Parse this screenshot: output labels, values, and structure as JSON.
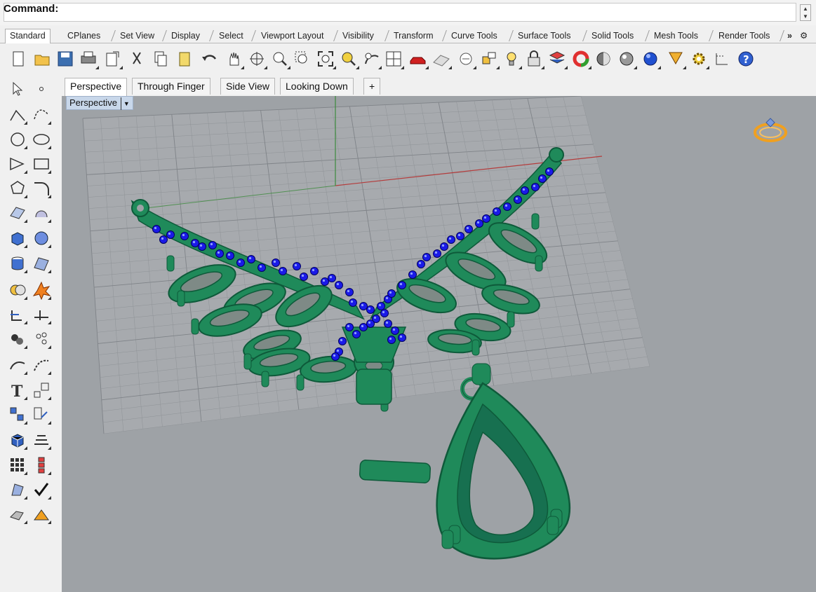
{
  "command": {
    "label": "Command:",
    "value": ""
  },
  "toolbar_tabs": [
    "Standard",
    "CPlanes",
    "Set View",
    "Display",
    "Select",
    "Viewport Layout",
    "Visibility",
    "Transform",
    "Curve Tools",
    "Surface Tools",
    "Solid Tools",
    "Mesh Tools",
    "Render Tools",
    "»"
  ],
  "main_toolbar_icons": [
    "new-icon",
    "open-icon",
    "save-icon",
    "print-icon",
    "import-icon",
    "cut-icon",
    "copy-icon",
    "paste-icon",
    "undo-icon",
    "pan-icon",
    "rotate-view-icon",
    "zoom-dynamic-icon",
    "zoom-window-icon",
    "zoom-extents-icon",
    "zoom-selected-icon",
    "undo-view-icon",
    "viewport-layout-icon",
    "car-icon",
    "cplane-icon",
    "select-icon",
    "named-view-icon",
    "light-icon",
    "lock-icon",
    "layer-icon",
    "color-wheel-icon",
    "shade-icon",
    "rendered-icon",
    "render-sphere-icon",
    "properties-icon",
    "options-gear-icon",
    "dimension-icon",
    "help-icon"
  ],
  "left_toolbar_icons": [
    "select-arrow-icon",
    "point-icon",
    "polyline-icon",
    "curve-icon",
    "circle-icon",
    "ellipse-icon",
    "arc-icon",
    "rectangle-icon",
    "polygon-icon",
    "fillet-icon",
    "surface-icon",
    "revolve-icon",
    "box-icon",
    "sphere-icon",
    "cylinder-icon",
    "patch-icon",
    "boolean-icon",
    "explode-icon",
    "trim-icon",
    "split-icon",
    "group-icon",
    "points-on-icon",
    "offset-icon",
    "blend-icon",
    "text-icon",
    "scale-icon",
    "array-icon",
    "flow-icon",
    "mesh-icon",
    "dims-icon",
    "grid-icon",
    "layout-icon",
    "analyze-icon",
    "check-icon",
    "render-icon",
    "sun-icon"
  ],
  "viewport_tabs": [
    "Perspective",
    "Through Finger",
    "Side View",
    "Looking Down",
    "+"
  ],
  "viewport": {
    "title": "Perspective",
    "dropdown": "▼"
  },
  "colors": {
    "model": "#1f8a5a",
    "model_dark": "#0e5a3a",
    "gem": "#1a1ae8",
    "viewport_bg": "#9ea2a6",
    "grid": "#8c9095",
    "x_axis": "#b43c3c",
    "y_axis": "#3c8a3c",
    "title_bg": "#c8d7ea",
    "ring_icon": "#f0a020"
  }
}
